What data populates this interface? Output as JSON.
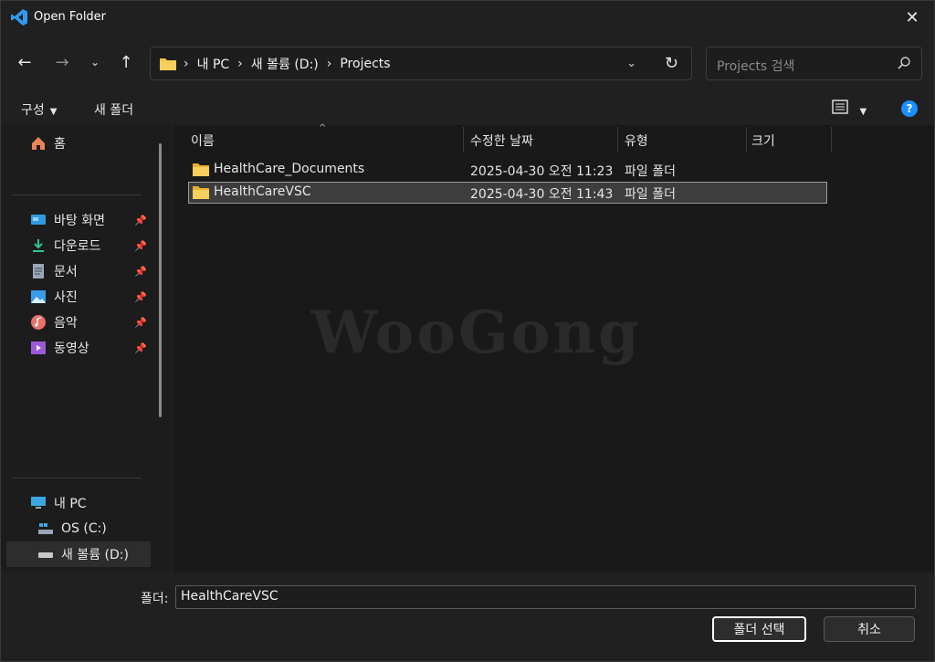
{
  "window": {
    "title": "Open Folder",
    "close_icon": "close-icon"
  },
  "nav": {
    "back_icon": "arrow-left-icon",
    "forward_icon": "arrow-right-icon",
    "recent_icon": "chevron-down-icon",
    "up_icon": "arrow-up-icon"
  },
  "address": {
    "crumbs": [
      "내 PC",
      "새 볼륨 (D:)",
      "Projects"
    ],
    "separator": "›"
  },
  "search": {
    "placeholder": "Projects 검색"
  },
  "commands": {
    "organize": "구성",
    "new_folder": "새 폴더"
  },
  "sidebar": {
    "home": "홈",
    "quick": [
      {
        "label": "바탕 화면",
        "icon": "desktop-icon"
      },
      {
        "label": "다운로드",
        "icon": "download-icon"
      },
      {
        "label": "문서",
        "icon": "document-icon"
      },
      {
        "label": "사진",
        "icon": "picture-icon"
      },
      {
        "label": "음악",
        "icon": "music-icon"
      },
      {
        "label": "동영상",
        "icon": "video-icon"
      }
    ],
    "pc": "내 PC",
    "drives": [
      "OS (C:)",
      "새 볼륨 (D:)"
    ]
  },
  "columns": {
    "name": "이름",
    "modified": "수정한 날짜",
    "type": "유형",
    "size": "크기"
  },
  "files": [
    {
      "name": "HealthCare_Documents",
      "modified": "2025-04-30 오전 11:23",
      "type": "파일 폴더",
      "selected": false
    },
    {
      "name": "HealthCareVSC",
      "modified": "2025-04-30 오전 11:43",
      "type": "파일 폴더",
      "selected": true
    }
  ],
  "watermark": "WooGong",
  "footer": {
    "folder_label": "폴더:",
    "folder_value": "HealthCareVSC",
    "select_button": "폴더 선택",
    "cancel_button": "취소"
  },
  "colors": {
    "accent": "#1a8fff",
    "folder": "#f5c542",
    "background": "#202020"
  }
}
